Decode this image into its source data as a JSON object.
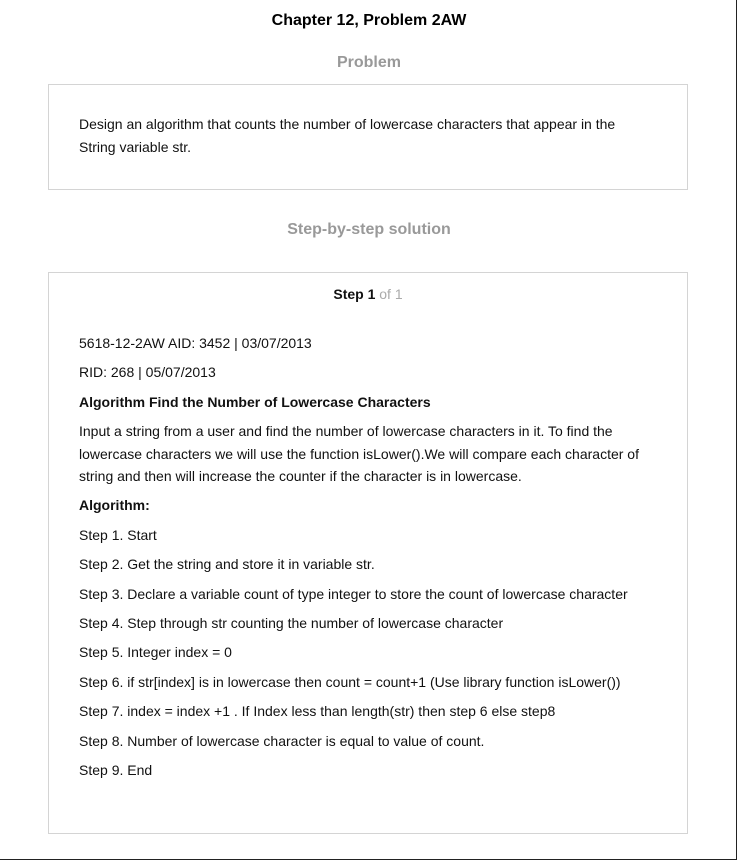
{
  "document": {
    "title": "Chapter 12, Problem 2AW",
    "problem_heading": "Problem",
    "problem_text": "Design an algorithm that counts the number of lowercase characters that appear in the String variable str.",
    "solution_heading": "Step-by-step solution",
    "step_header": {
      "step_word": "Step 1",
      "step_of": "of 1"
    },
    "solution": {
      "meta_line_1": "5618-12-2AW AID: 3452 | 03/07/2013",
      "meta_line_2": "RID: 268 | 05/07/2013",
      "algorithm_title": "Algorithm Find the Number of Lowercase Characters",
      "description": "Input a string from a user and find the number of lowercase characters in it. To find the lowercase characters we will use the function isLower().We will compare each character of string and then will increase the counter if the character is in lowercase.",
      "algorithm_label": "Algorithm:",
      "steps": [
        "Step 1. Start",
        "Step 2. Get the string and store it in variable str.",
        "Step 3. Declare a variable count of type integer to store the count of lowercase character",
        "Step 4. Step through str counting the number of lowercase character",
        "Step 5. Integer index = 0",
        "Step 6. if str[index] is in lowercase then count = count+1 (Use library function isLower())",
        "Step 7. index = index +1 . If Index less than length(str) then step 6 else step8",
        "Step 8. Number of lowercase character is equal to value of count.",
        "Step 9. End"
      ]
    }
  }
}
